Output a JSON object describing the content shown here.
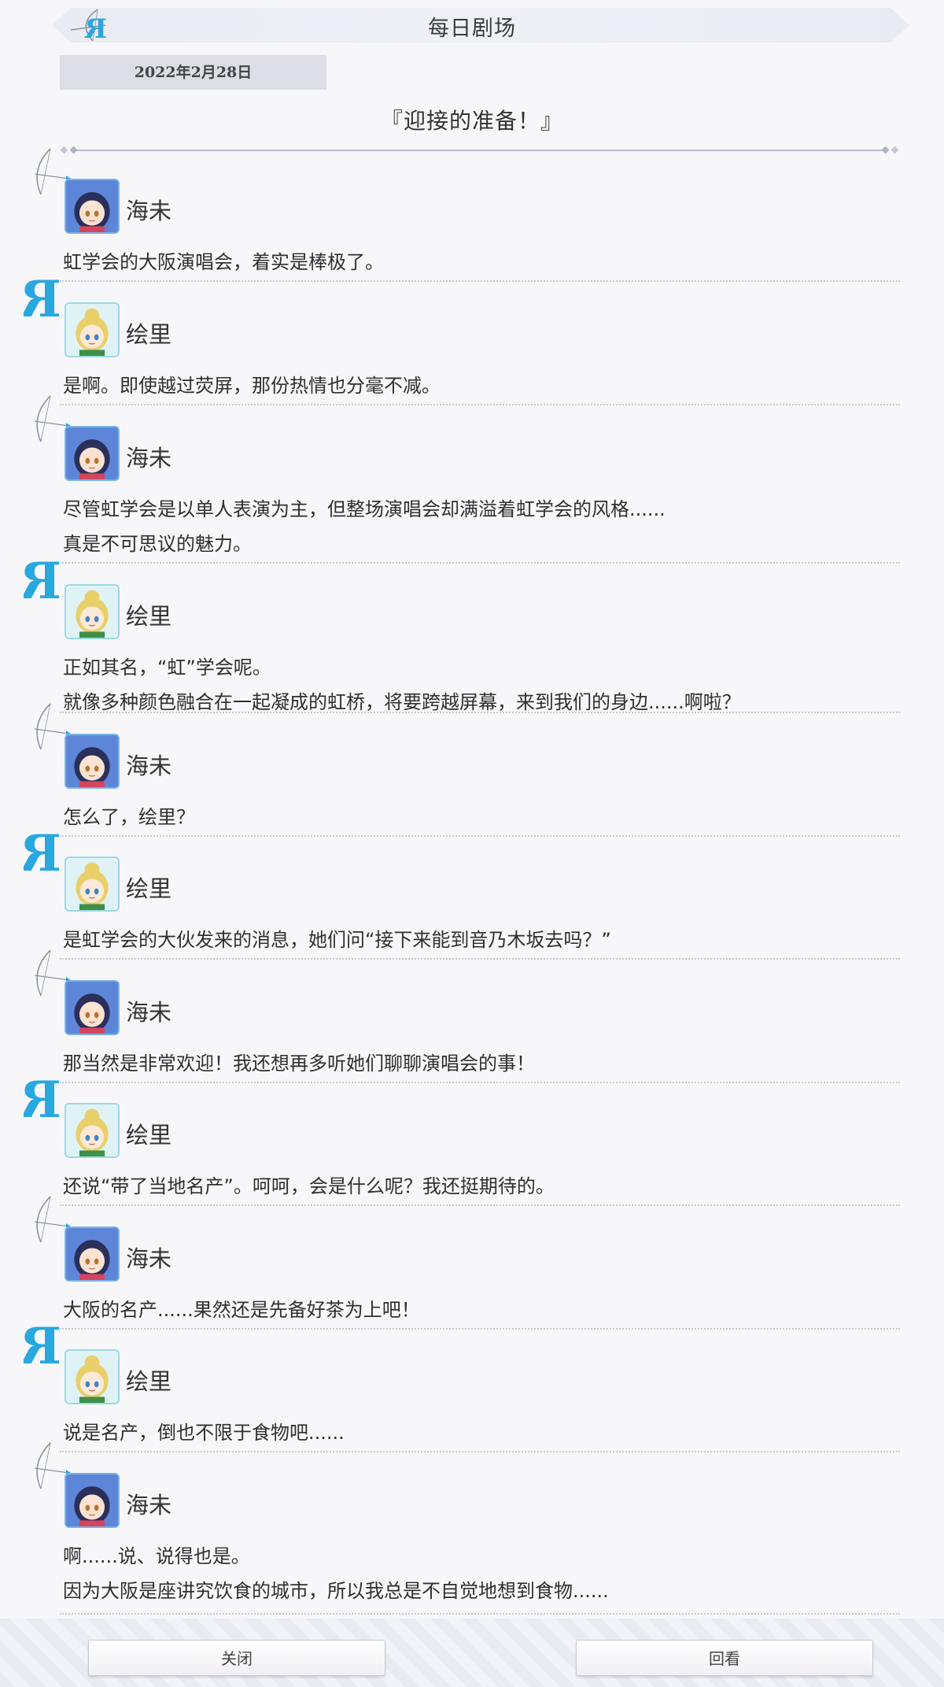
{
  "header": {
    "title": "每日剧场",
    "logo": "bow-arrow-R-logo"
  },
  "date": "2022年2月28日",
  "episode_title": "『迎接的准备！』",
  "footer": {
    "close_label": "关闭",
    "review_label": "回看"
  },
  "colors": {
    "accent_blue": "#29a8e0",
    "umi_avatar_bg": "#5d86d9",
    "eli_avatar_bg": "#dff3f7"
  },
  "dialogue": [
    {
      "speaker": "海未",
      "mark": "bow-icon",
      "lines": [
        "虹学会的大阪演唱会，着实是棒极了。"
      ]
    },
    {
      "speaker": "绘里",
      "mark": "letter-r-icon",
      "lines": [
        "是啊。即使越过荧屏，那份热情也分毫不减。"
      ]
    },
    {
      "speaker": "海未",
      "mark": "bow-icon",
      "lines": [
        "尽管虹学会是以单人表演为主，但整场演唱会却满溢着虹学会的风格......",
        "真是不可思议的魅力。"
      ]
    },
    {
      "speaker": "绘里",
      "mark": "letter-r-icon",
      "lines": [
        "正如其名，“虹”学会呢。",
        "就像多种颜色融合在一起凝成的虹桥，将要跨越屏幕，来到我们的身边......啊啦？"
      ]
    },
    {
      "speaker": "海未",
      "mark": "bow-icon",
      "lines": [
        "怎么了，绘里？"
      ]
    },
    {
      "speaker": "绘里",
      "mark": "letter-r-icon",
      "lines": [
        "是虹学会的大伙发来的消息，她们问“接下来能到音乃木坂去吗？”"
      ]
    },
    {
      "speaker": "海未",
      "mark": "bow-icon",
      "lines": [
        "那当然是非常欢迎！我还想再多听她们聊聊演唱会的事！"
      ]
    },
    {
      "speaker": "绘里",
      "mark": "letter-r-icon",
      "lines": [
        "还说“带了当地名产”。呵呵，会是什么呢？我还挺期待的。"
      ]
    },
    {
      "speaker": "海未",
      "mark": "bow-icon",
      "lines": [
        "大阪的名产......果然还是先备好茶为上吧！"
      ]
    },
    {
      "speaker": "绘里",
      "mark": "letter-r-icon",
      "lines": [
        "说是名产，倒也不限于食物吧......"
      ]
    },
    {
      "speaker": "海未",
      "mark": "bow-icon",
      "lines": [
        "啊......说、说得也是。",
        "因为大阪是座讲究饮食的城市，所以我总是不自觉地想到食物......"
      ]
    }
  ]
}
